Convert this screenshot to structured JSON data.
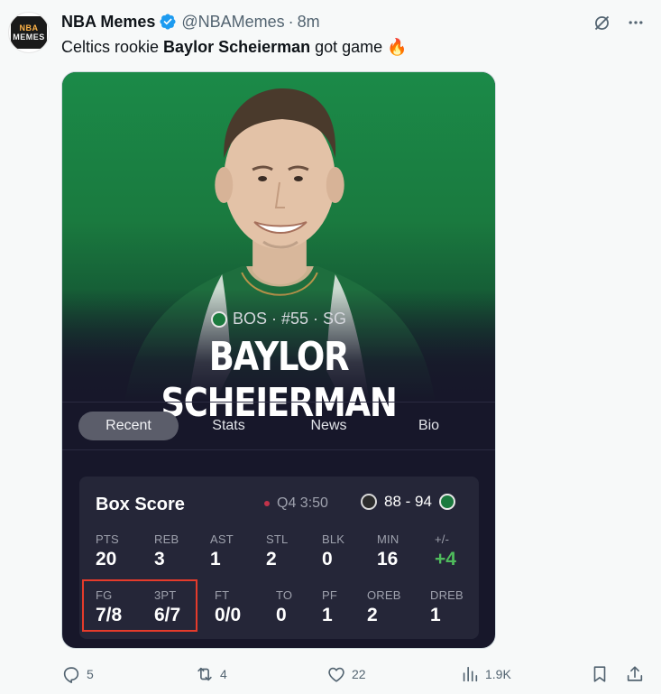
{
  "post": {
    "author_name": "NBA Memes",
    "handle": "@NBAMemes",
    "separator": "·",
    "time": "8m",
    "avatar_text_top": "NBA",
    "avatar_text_bottom": "MEMES",
    "text_before": "Celtics rookie ",
    "text_bold": "Baylor Scheierman",
    "text_after": " got game ",
    "emoji": "🔥",
    "icons": [
      "grok-icon",
      "more-icon"
    ]
  },
  "card": {
    "team_line": "BOS · #55 · SG",
    "player_name": "BAYLOR SCHEIERMAN",
    "tabs": [
      {
        "label": "Recent",
        "active": true
      },
      {
        "label": "Stats",
        "active": false
      },
      {
        "label": "News",
        "active": false
      },
      {
        "label": "Bio",
        "active": false
      }
    ],
    "box_score": {
      "title": "Box Score",
      "clock": "Q4 3:50",
      "score": "88 - 94",
      "row1": [
        {
          "label": "PTS",
          "value": "20"
        },
        {
          "label": "REB",
          "value": "3"
        },
        {
          "label": "AST",
          "value": "1"
        },
        {
          "label": "STL",
          "value": "2"
        },
        {
          "label": "BLK",
          "value": "0"
        },
        {
          "label": "MIN",
          "value": "16"
        },
        {
          "label": "+/-",
          "value": "+4"
        }
      ],
      "row2": [
        {
          "label": "FG",
          "value": "7/8"
        },
        {
          "label": "3PT",
          "value": "6/7"
        },
        {
          "label": "FT",
          "value": "0/0"
        },
        {
          "label": "TO",
          "value": "0"
        },
        {
          "label": "PF",
          "value": "1"
        },
        {
          "label": "OREB",
          "value": "2"
        },
        {
          "label": "DREB",
          "value": "1"
        }
      ]
    },
    "colors": {
      "accent_green": "#4fbb5c",
      "highlight_red": "#e53b2b",
      "panel": "#252638"
    }
  },
  "actions": {
    "replies": "5",
    "reposts": "4",
    "likes": "22",
    "views": "1.9K"
  }
}
